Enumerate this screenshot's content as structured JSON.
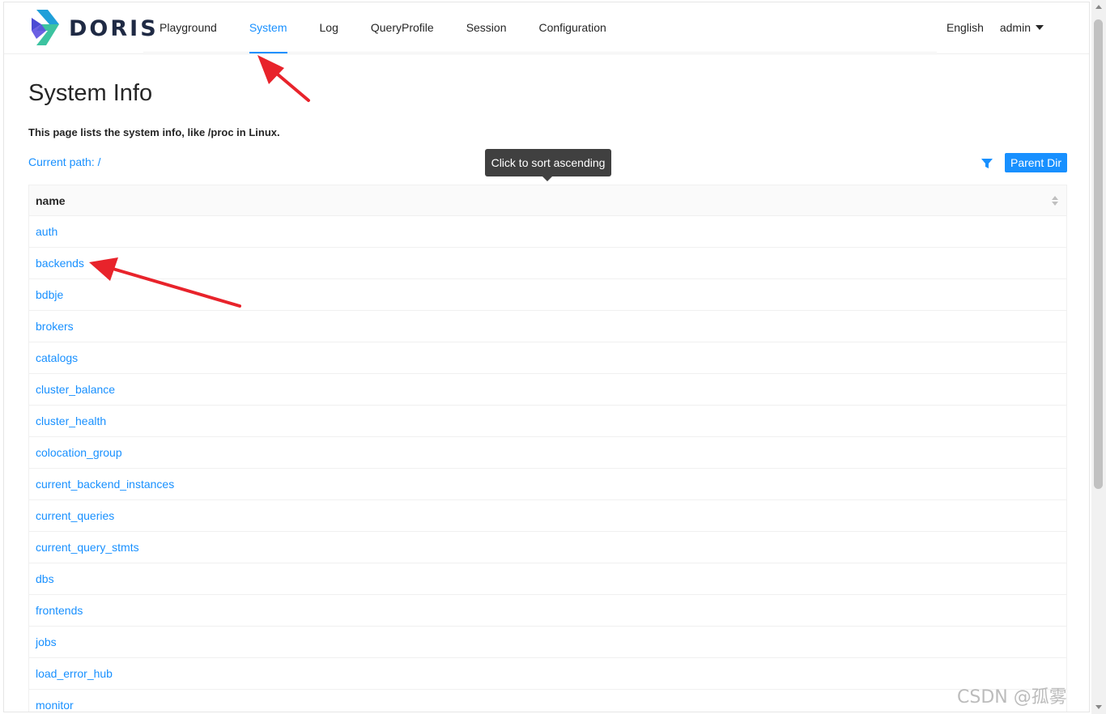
{
  "header": {
    "logo_text": "DORIS",
    "nav": [
      "Playground",
      "System",
      "Log",
      "QueryProfile",
      "Session",
      "Configuration"
    ],
    "active_nav": "System",
    "language": "English",
    "user": "admin"
  },
  "main": {
    "title": "System Info",
    "description": "This page lists the system info, like /proc in Linux.",
    "current_path": "Current path: /",
    "parent_dir_label": "Parent Dir",
    "tooltip": "Click to sort ascending",
    "table": {
      "column_header": "name",
      "rows": [
        "auth",
        "backends",
        "bdbje",
        "brokers",
        "catalogs",
        "cluster_balance",
        "cluster_health",
        "colocation_group",
        "current_backend_instances",
        "current_queries",
        "current_query_stmts",
        "dbs",
        "frontends",
        "jobs",
        "load_error_hub",
        "monitor"
      ]
    }
  },
  "watermark": "CSDN @孤雾",
  "colors": {
    "accent": "#1890ff",
    "annotation_arrow": "#e8232b"
  }
}
